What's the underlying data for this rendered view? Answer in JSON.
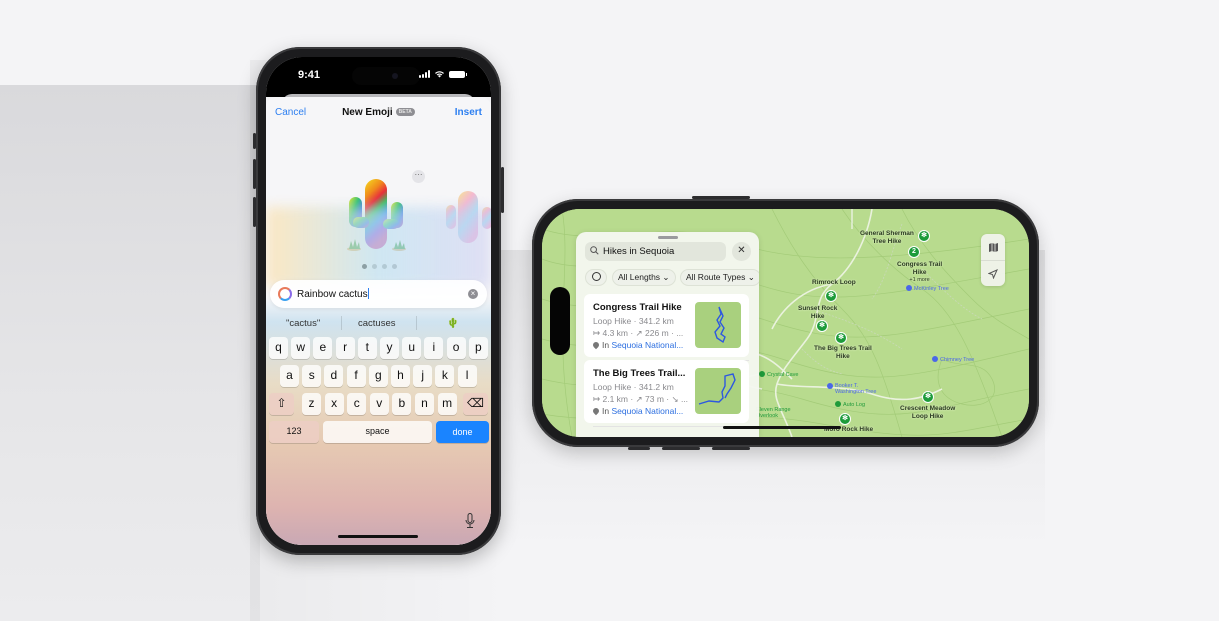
{
  "emoji_phone": {
    "status_bar": {
      "time": "9:41"
    },
    "sheet": {
      "cancel_label": "Cancel",
      "title": "New Emoji",
      "badge": "BETA",
      "insert_label": "Insert"
    },
    "emoji_preview": {
      "more_label": "···",
      "current_emoji": "rainbow-cactus",
      "page_count": 4,
      "current_page": 1
    },
    "prompt": {
      "value": "Rainbow cactus",
      "clear_label": "×"
    },
    "suggestions": [
      "\"cactus\"",
      "cactuses",
      "🌵"
    ],
    "keyboard": {
      "row1": [
        "q",
        "w",
        "e",
        "r",
        "t",
        "y",
        "u",
        "i",
        "o",
        "p"
      ],
      "row2": [
        "a",
        "s",
        "d",
        "f",
        "g",
        "h",
        "j",
        "k",
        "l"
      ],
      "row3": [
        "z",
        "x",
        "c",
        "v",
        "b",
        "n",
        "m"
      ],
      "shift_label": "⇧",
      "delete_label": "⌫",
      "numbers_label": "123",
      "space_label": "space",
      "done_label": "done"
    },
    "accent_color": "#1a84ff"
  },
  "maps_phone": {
    "search": {
      "value": "Hikes in Sequoia"
    },
    "filters": [
      "All Lengths",
      "All Route Types"
    ],
    "results": [
      {
        "title": "Congress Trail Hike",
        "subtitle": "Loop Hike · 341.2 km",
        "stats": "↦ 4.3 km · ↗ 226 m · ...",
        "location_prefix": "In",
        "location_link": "Sequoia National..."
      },
      {
        "title": "The Big Trees Trail...",
        "subtitle": "Loop Hike · 341.2 km",
        "stats": "↦ 2.1 km · ↗ 73 m · ↘ ...",
        "location_prefix": "In",
        "location_link": "Sequoia National..."
      }
    ],
    "map_labels": {
      "general_sherman": "General Sherman\nTree Hike",
      "congress_trail": "Congress Trail\nHike",
      "congress_more": "+1 more",
      "cluster_count": "2",
      "rimrock": "Rimrock Loop",
      "sunset_rock": "Sunset Rock\nHike",
      "big_trees": "The Big Trees Trail\nHike",
      "crescent_meadow": "Crescent Meadow\nLoop Hike",
      "moro_rock": "Moro Rock Hike",
      "mckinley_tree": "McKinley Tree",
      "chimney_tree": "Chimney Tree",
      "crystal_cave": "Crystal Cave",
      "booker_washington": "Booker T.\nWashington Tree",
      "auto_log": "Auto Log",
      "eleven_range": "Eleven Range\nOverlook"
    },
    "link_color": "#2d6fe0",
    "map_green": "#b8db8e",
    "pin_green": "#1c9b3a"
  }
}
